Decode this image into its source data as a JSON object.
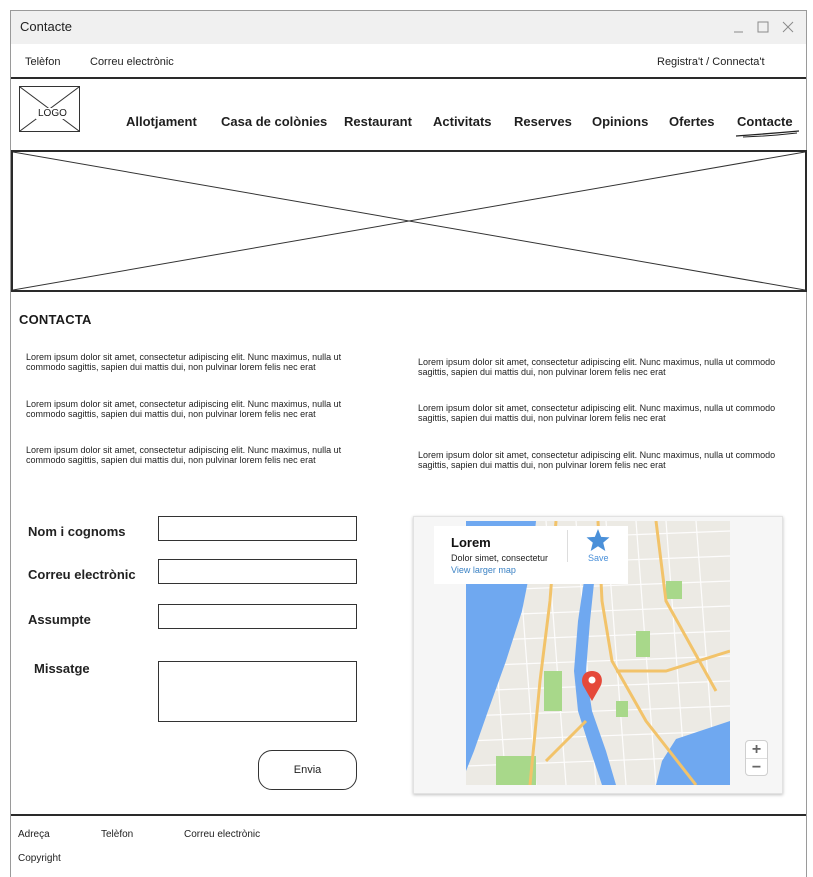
{
  "window": {
    "title": "Contacte"
  },
  "topbar": {
    "phone": "Telèfon",
    "email": "Correu electrònic",
    "account": "Registra't / Connecta't"
  },
  "logo": {
    "label": "LOGO"
  },
  "nav": {
    "items": [
      "Allotjament",
      "Casa de colònies",
      "Restaurant",
      "Activitats",
      "Reserves",
      "Opinions",
      "Ofertes",
      "Contacte"
    ],
    "active": "Contacte"
  },
  "section": {
    "title": "CONTACTA"
  },
  "paragraphs": {
    "left": [
      "Lorem ipsum dolor sit amet, consectetur adipiscing elit. Nunc maximus, nulla ut commodo sagittis, sapien dui mattis dui, non pulvinar lorem felis nec erat",
      "Lorem ipsum dolor sit amet, consectetur adipiscing elit. Nunc maximus, nulla ut commodo sagittis, sapien dui mattis dui, non pulvinar lorem felis nec erat",
      "Lorem ipsum dolor sit amet, consectetur adipiscing elit. Nunc maximus, nulla ut commodo sagittis, sapien dui mattis dui, non pulvinar lorem felis nec erat"
    ],
    "right": [
      "Lorem ipsum dolor sit amet, consectetur adipiscing elit. Nunc maximus, nulla ut commodo sagittis, sapien dui mattis dui, non pulvinar lorem felis nec erat",
      "Lorem ipsum dolor sit amet, consectetur adipiscing elit. Nunc maximus, nulla ut commodo sagittis, sapien dui mattis dui, non pulvinar lorem felis nec erat",
      "Lorem ipsum dolor sit amet, consectetur adipiscing elit. Nunc maximus, nulla ut commodo sagittis, sapien dui mattis dui, non pulvinar lorem felis nec erat"
    ]
  },
  "form": {
    "name_label": "Nom i cognoms",
    "email_label": "Correu electrònic",
    "subject_label": "Assumpte",
    "message_label": "Missatge",
    "name_value": "",
    "email_value": "",
    "subject_value": "",
    "message_value": "",
    "submit_label": "Envia"
  },
  "map": {
    "place_name": "Lorem",
    "place_address": "Dolor simet, consectetur",
    "larger_link": "View larger map",
    "save_label": "Save",
    "zoom_in": "+",
    "zoom_out": "−",
    "colors": {
      "water": "#6fa8f0",
      "park": "#a8d88a",
      "road": "#f2c36a",
      "pin": "#e5493a",
      "link": "#3b82c4"
    }
  },
  "footer": {
    "address": "Adreça",
    "phone": "Telèfon",
    "email": "Correu electrònic",
    "copyright": "Copyright"
  }
}
